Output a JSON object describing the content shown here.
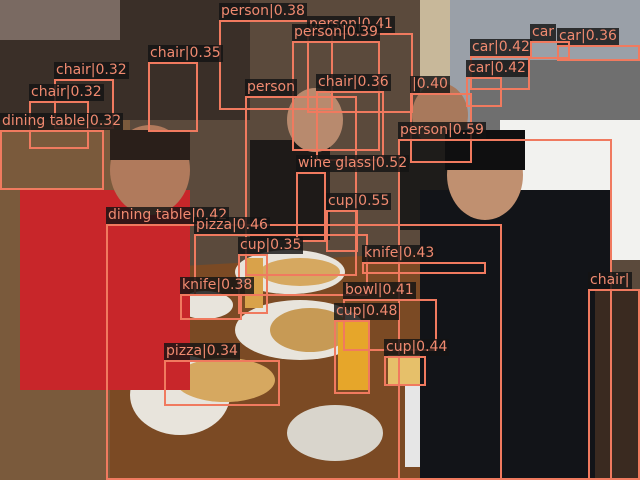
{
  "colors": {
    "box": "#f07a5f",
    "label_text": "#f08a70",
    "label_bg": "#141414"
  },
  "detections": [
    {
      "label": "person|0.38"
    },
    {
      "label": "person|0.41"
    },
    {
      "label": "person|0.39"
    },
    {
      "label": "chair|0.35"
    },
    {
      "label": "chair|0.32"
    },
    {
      "label": "chair|0.32"
    },
    {
      "label": "dining table|0.32"
    },
    {
      "label": "person"
    },
    {
      "label": "chair|0.36"
    },
    {
      "label": "|0.40"
    },
    {
      "label": "car|0.42"
    },
    {
      "label": "car|0.42"
    },
    {
      "label": "car|0.36"
    },
    {
      "label": "car"
    },
    {
      "label": "person|0.59"
    },
    {
      "label": "wine glass|0.52"
    },
    {
      "label": "cup|0.55"
    },
    {
      "label": "dining table|0.42"
    },
    {
      "label": "pizza|0.46"
    },
    {
      "label": "cup|0.35"
    },
    {
      "label": "knife|0.43"
    },
    {
      "label": "knife|0.38"
    },
    {
      "label": "bowl|0.41"
    },
    {
      "label": "cup|0.48"
    },
    {
      "label": "cup|0.44"
    },
    {
      "label": "pizza|0.34"
    },
    {
      "label": "chair|"
    }
  ]
}
